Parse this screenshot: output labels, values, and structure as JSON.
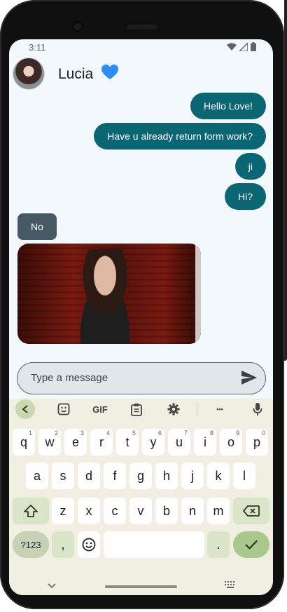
{
  "status_bar": {
    "time": "3:11"
  },
  "chat": {
    "contact_name": "Lucia",
    "messages": [
      {
        "direction": "out",
        "text": "Hello Love!"
      },
      {
        "direction": "out",
        "text": "Have u already return form work?"
      },
      {
        "direction": "out",
        "text": "ji"
      },
      {
        "direction": "out",
        "text": "Hi?"
      },
      {
        "direction": "in",
        "text": "No"
      },
      {
        "direction": "in",
        "type": "gif"
      }
    ]
  },
  "composer": {
    "placeholder": "Type a message"
  },
  "keyboard": {
    "toolbar": {
      "gif_label": "GIF",
      "more_label": "•••"
    },
    "row1": [
      {
        "label": "q",
        "hint": "1"
      },
      {
        "label": "w",
        "hint": "2"
      },
      {
        "label": "e",
        "hint": "3"
      },
      {
        "label": "r",
        "hint": "4"
      },
      {
        "label": "t",
        "hint": "5"
      },
      {
        "label": "y",
        "hint": "6"
      },
      {
        "label": "u",
        "hint": "7"
      },
      {
        "label": "i",
        "hint": "8"
      },
      {
        "label": "o",
        "hint": "9"
      },
      {
        "label": "p",
        "hint": "0"
      }
    ],
    "row2": [
      "a",
      "s",
      "d",
      "f",
      "g",
      "h",
      "j",
      "k",
      "l"
    ],
    "row3": [
      "z",
      "x",
      "c",
      "v",
      "b",
      "n",
      "m"
    ],
    "symbols_label": "?123",
    "comma_label": ",",
    "period_label": "."
  },
  "colors": {
    "outgoing_bubble": "#0b6674",
    "incoming_bubble": "#455a64",
    "heart": "#2a8ef5",
    "chat_background": "#f2f8fc",
    "keyboard_background": "#f0efe2",
    "enter_key": "#a9c98c"
  },
  "icons": [
    "heart-icon",
    "send-icon",
    "back-chevron-icon",
    "sticker-icon",
    "clipboard-icon",
    "gear-icon",
    "more-icon",
    "mic-icon",
    "shift-icon",
    "backspace-icon",
    "emoji-icon",
    "check-icon",
    "hide-keyboard-icon",
    "keyboard-switch-icon",
    "wifi-icon",
    "signal-icon",
    "battery-icon"
  ]
}
